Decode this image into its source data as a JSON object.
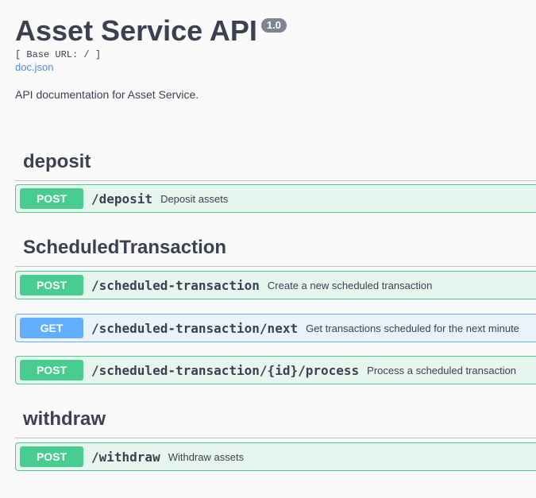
{
  "info": {
    "title": "Asset Service API",
    "version": "1.0",
    "base_url": "[ Base URL: / ]",
    "doc_link": "doc.json",
    "description": "API documentation for Asset Service."
  },
  "tags": [
    {
      "name": "deposit",
      "operations": [
        {
          "method": "POST",
          "path": "/deposit",
          "summary": "Deposit assets"
        }
      ]
    },
    {
      "name": "ScheduledTransaction",
      "operations": [
        {
          "method": "POST",
          "path": "/scheduled-transaction",
          "summary": "Create a new scheduled transaction"
        },
        {
          "method": "GET",
          "path": "/scheduled-transaction/next",
          "summary": "Get transactions scheduled for the next minute"
        },
        {
          "method": "POST",
          "path": "/scheduled-transaction/{id}/process",
          "summary": "Process a scheduled transaction"
        }
      ]
    },
    {
      "name": "withdraw",
      "operations": [
        {
          "method": "POST",
          "path": "/withdraw",
          "summary": "Withdraw assets"
        }
      ]
    }
  ],
  "colors": {
    "post": "#49cc90",
    "get": "#61affe",
    "text": "#3b4151",
    "link": "#4990e2",
    "version_badge": "#7d8492"
  }
}
